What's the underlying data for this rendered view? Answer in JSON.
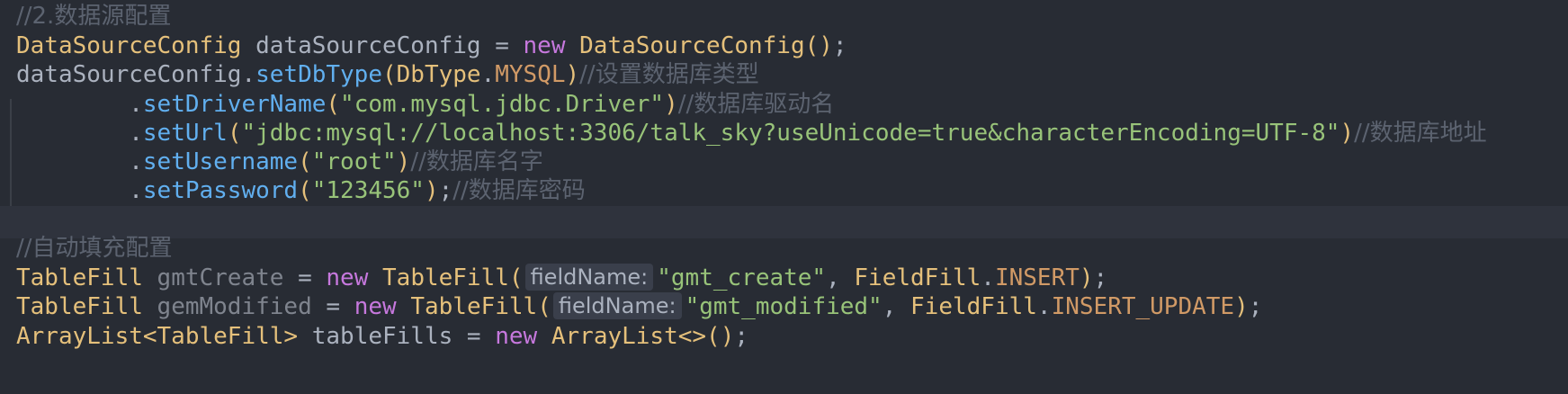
{
  "code": {
    "l1": {
      "comment": "//2.数据源配置"
    },
    "l2": {
      "type": "DataSourceConfig",
      "var": " dataSourceConfig ",
      "eq": "=",
      "kw": " new ",
      "ctor": "DataSourceConfig",
      "paren_open": "(",
      "paren_close": ")",
      "semi": ";"
    },
    "l3": {
      "obj": "dataSourceConfig",
      "dot": ".",
      "method": "setDbType",
      "paren_open": "(",
      "enum_type": "DbType",
      "dot2": ".",
      "enum_val": "MYSQL",
      "paren_close": ")",
      "comment": "//设置数据库类型"
    },
    "l4": {
      "indent": "        ",
      "dot": ".",
      "method": "setDriverName",
      "paren_open": "(",
      "str": "\"com.mysql.jdbc.Driver\"",
      "paren_close": ")",
      "comment": "//数据库驱动名"
    },
    "l5": {
      "indent": "        ",
      "dot": ".",
      "method": "setUrl",
      "paren_open": "(",
      "str": "\"jdbc:mysql://localhost:3306/talk_sky?useUnicode=true&characterEncoding=UTF-8\"",
      "paren_close": ")",
      "comment": "//数据库地址"
    },
    "l6": {
      "indent": "        ",
      "dot": ".",
      "method": "setUsername",
      "paren_open": "(",
      "str": "\"root\"",
      "paren_close": ")",
      "comment": "//数据库名字"
    },
    "l7": {
      "indent": "        ",
      "dot": ".",
      "method": "setPassword",
      "paren_open": "(",
      "str": "\"123456\"",
      "paren_close": ")",
      "semi": ";",
      "comment": "//数据库密码"
    },
    "l9": {
      "comment": "//自动填充配置"
    },
    "l10": {
      "type": "TableFill",
      "var": " gmtCreate ",
      "eq": "=",
      "kw": " new ",
      "ctor": "TableFill",
      "paren_open": "(",
      "hint": "fieldName:",
      "str": "\"gmt_create\"",
      "comma": ", ",
      "enum_type": "FieldFill",
      "dot": ".",
      "enum_val": "INSERT",
      "paren_close": ")",
      "semi": ";"
    },
    "l11": {
      "type": "TableFill",
      "var": " gemModified ",
      "eq": "=",
      "kw": " new ",
      "ctor": "TableFill",
      "paren_open": "(",
      "hint": "fieldName:",
      "str": "\"gmt_modified\"",
      "comma": ", ",
      "enum_type": "FieldFill",
      "dot": ".",
      "enum_val": "INSERT_UPDATE",
      "paren_close": ")",
      "semi": ";"
    },
    "l12": {
      "type": "ArrayList<TableFill>",
      "var": " tableFills ",
      "eq": "=",
      "kw": " new ",
      "ctor": "ArrayList<>",
      "paren_open": "(",
      "paren_close": ")",
      "semi": ";"
    }
  }
}
